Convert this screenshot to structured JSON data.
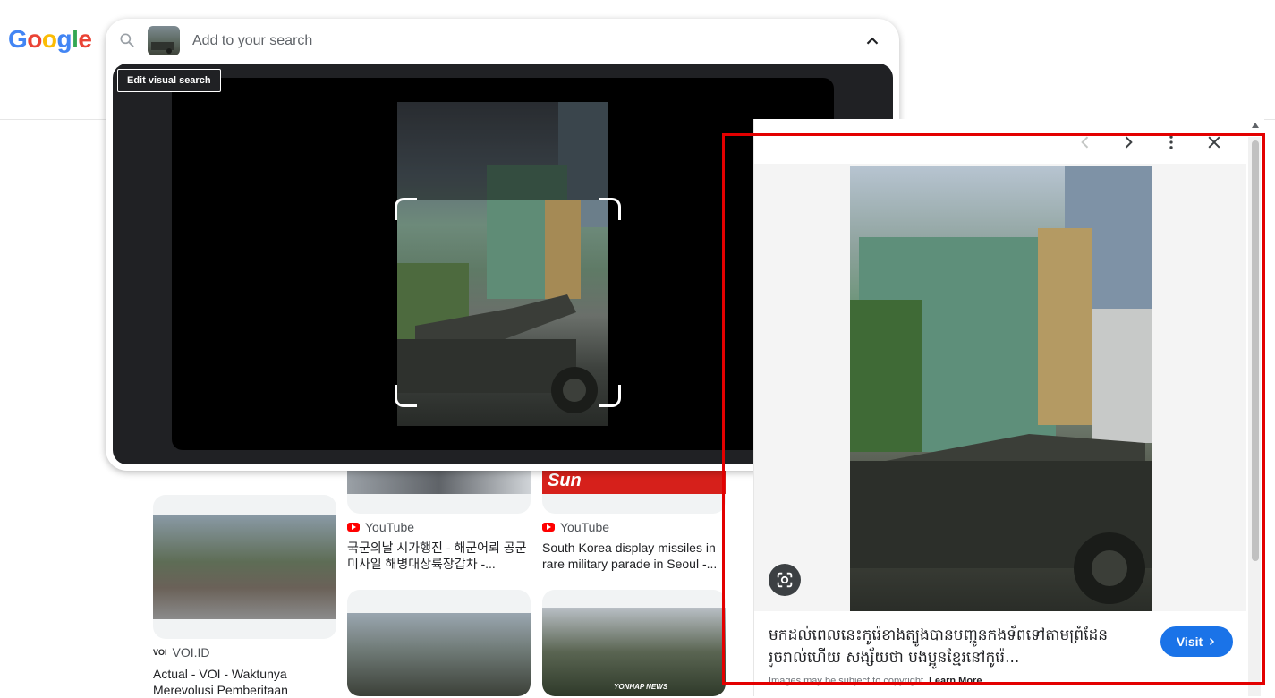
{
  "logo": {
    "g": "G",
    "o1": "o",
    "o2": "o",
    "g2": "g",
    "l": "l",
    "e": "e"
  },
  "search": {
    "placeholder": "Add to your search",
    "tooltip": "Edit visual search",
    "collapse_icon": "chevron-up-icon",
    "translate_icon": "translate-icon",
    "fullscreen_icon": "fullscreen-icon"
  },
  "results": [
    {
      "source": "YouTube",
      "title": "국군의날 시가행진 - 해군어뢰 공군미사일 해병대상륙장갑차 -..."
    },
    {
      "source": "YouTube",
      "title": "South Korea display missiles in rare military parade in Seoul -..."
    },
    {
      "source": "VOI.ID",
      "source_logo": "VOI",
      "title": "Actual - VOI - Waktunya Merevolusi Pemberitaan"
    }
  ],
  "card_labels": {
    "sun": "Sun",
    "yonhap": "YONHAP NEWS"
  },
  "detail": {
    "title": "មកដល់ពេលនេះកូរ៉េខាងត្បូងបានបញ្ជូនកងទ័ពទៅតាមព្រំដែនរួចរាល់ហើយ សង្ស័យថា បងប្អូនខ្មែរនៅកូរ៉េ...",
    "visit_label": "Visit",
    "disclaimer": "Images may be subject to copyright.",
    "learn_more": "Learn More"
  },
  "colors": {
    "accent": "#1a73e8",
    "highlight": "#e30000"
  }
}
